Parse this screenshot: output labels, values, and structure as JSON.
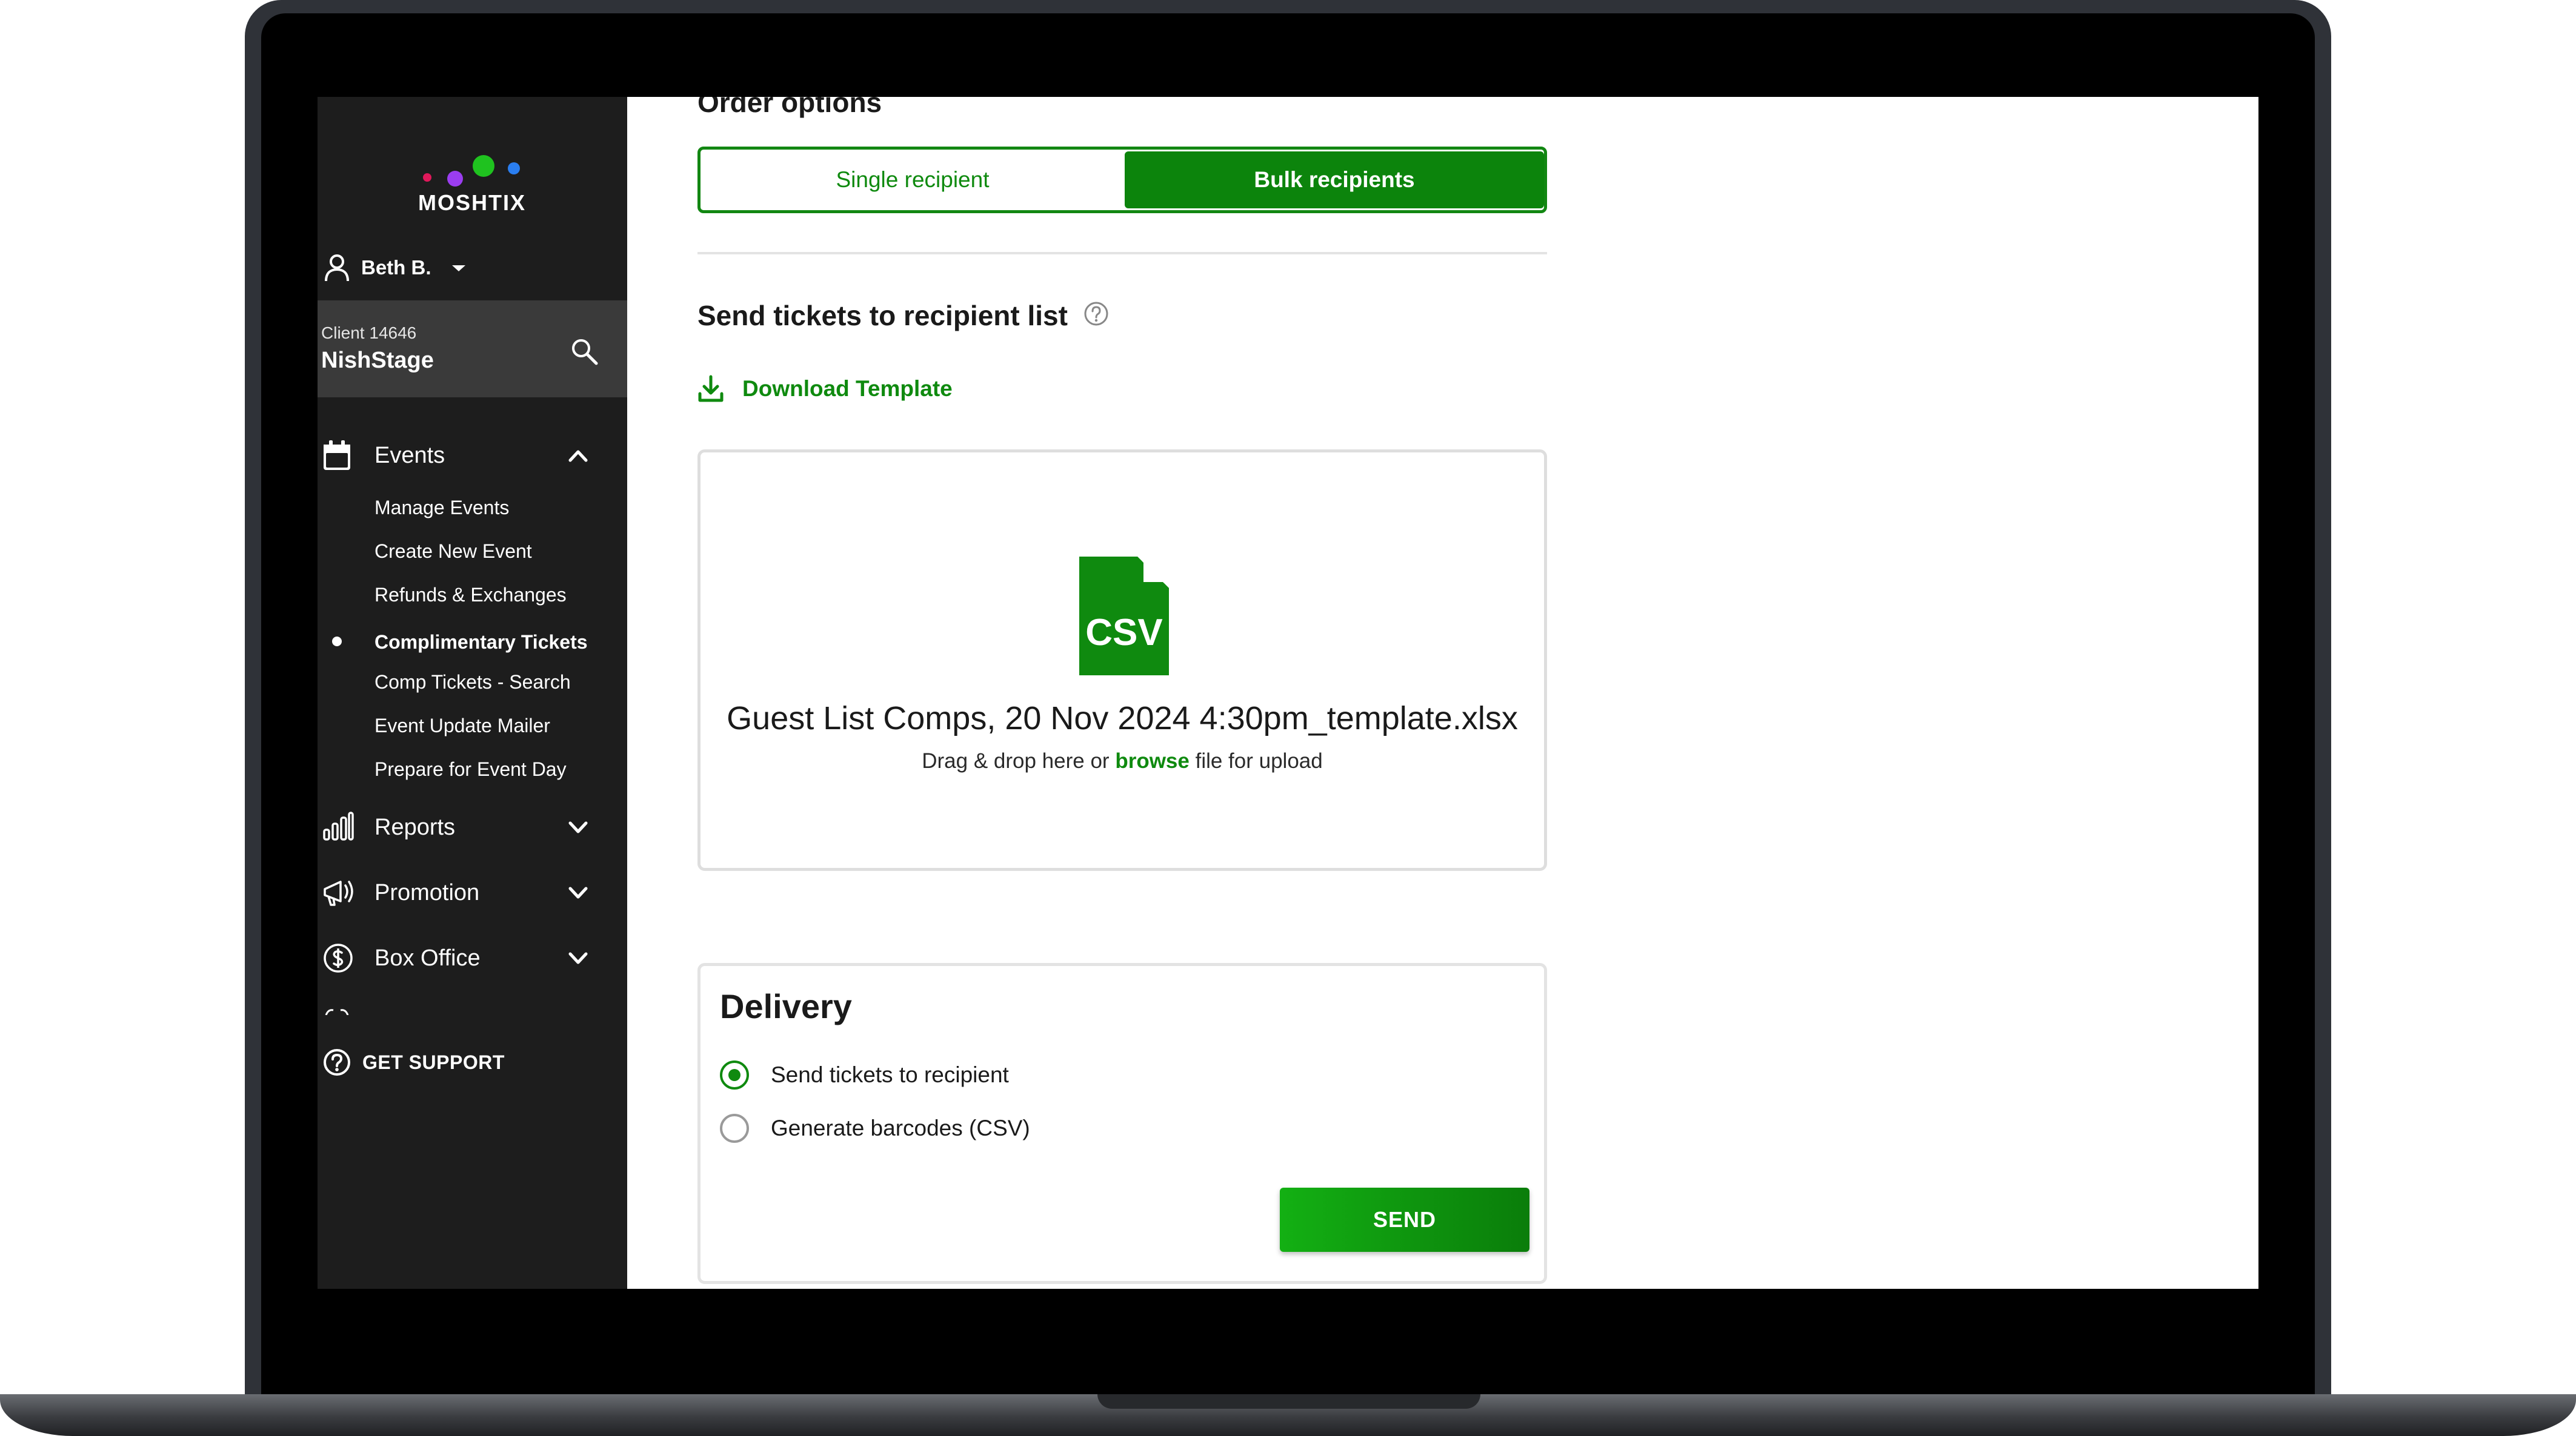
{
  "brand": {
    "name": "MOSHTIX",
    "accent": "#0c840c",
    "logo_dots": [
      "#e0185a",
      "#9b3df0",
      "#1fc21f",
      "#2a7ef0"
    ]
  },
  "sidebar": {
    "user_name": "Beth B.",
    "client_id": "Client 14646",
    "client_name": "NishStage",
    "events_label": "Events",
    "events_items": [
      "Manage Events",
      "Create New Event",
      "Refunds & Exchanges",
      "Complimentary Tickets",
      "Comp Tickets - Search",
      "Event Update Mailer",
      "Prepare for Event Day"
    ],
    "active_item": "Complimentary Tickets",
    "reports_label": "Reports",
    "promotion_label": "Promotion",
    "box_office_label": "Box Office",
    "support_label": "GET SUPPORT"
  },
  "main": {
    "section_title": "Order options",
    "toggle": {
      "single_label": "Single recipient",
      "bulk_label": "Bulk recipients",
      "selected": "Bulk recipients"
    },
    "send_title": "Send tickets to recipient list",
    "download_label": "Download Template",
    "dropzone": {
      "icon_label": "CSV",
      "file_name": "Guest List Comps, 20 Nov 2024 4:30pm_template.xlsx",
      "hint_before": "Drag & drop here or",
      "browse": "browse",
      "hint_after": "file for upload"
    },
    "delivery": {
      "title": "Delivery",
      "option_send": "Send tickets to recipient",
      "option_barcodes": "Generate barcodes (CSV)",
      "selected": "Send tickets to recipient",
      "send_button": "SEND"
    }
  }
}
